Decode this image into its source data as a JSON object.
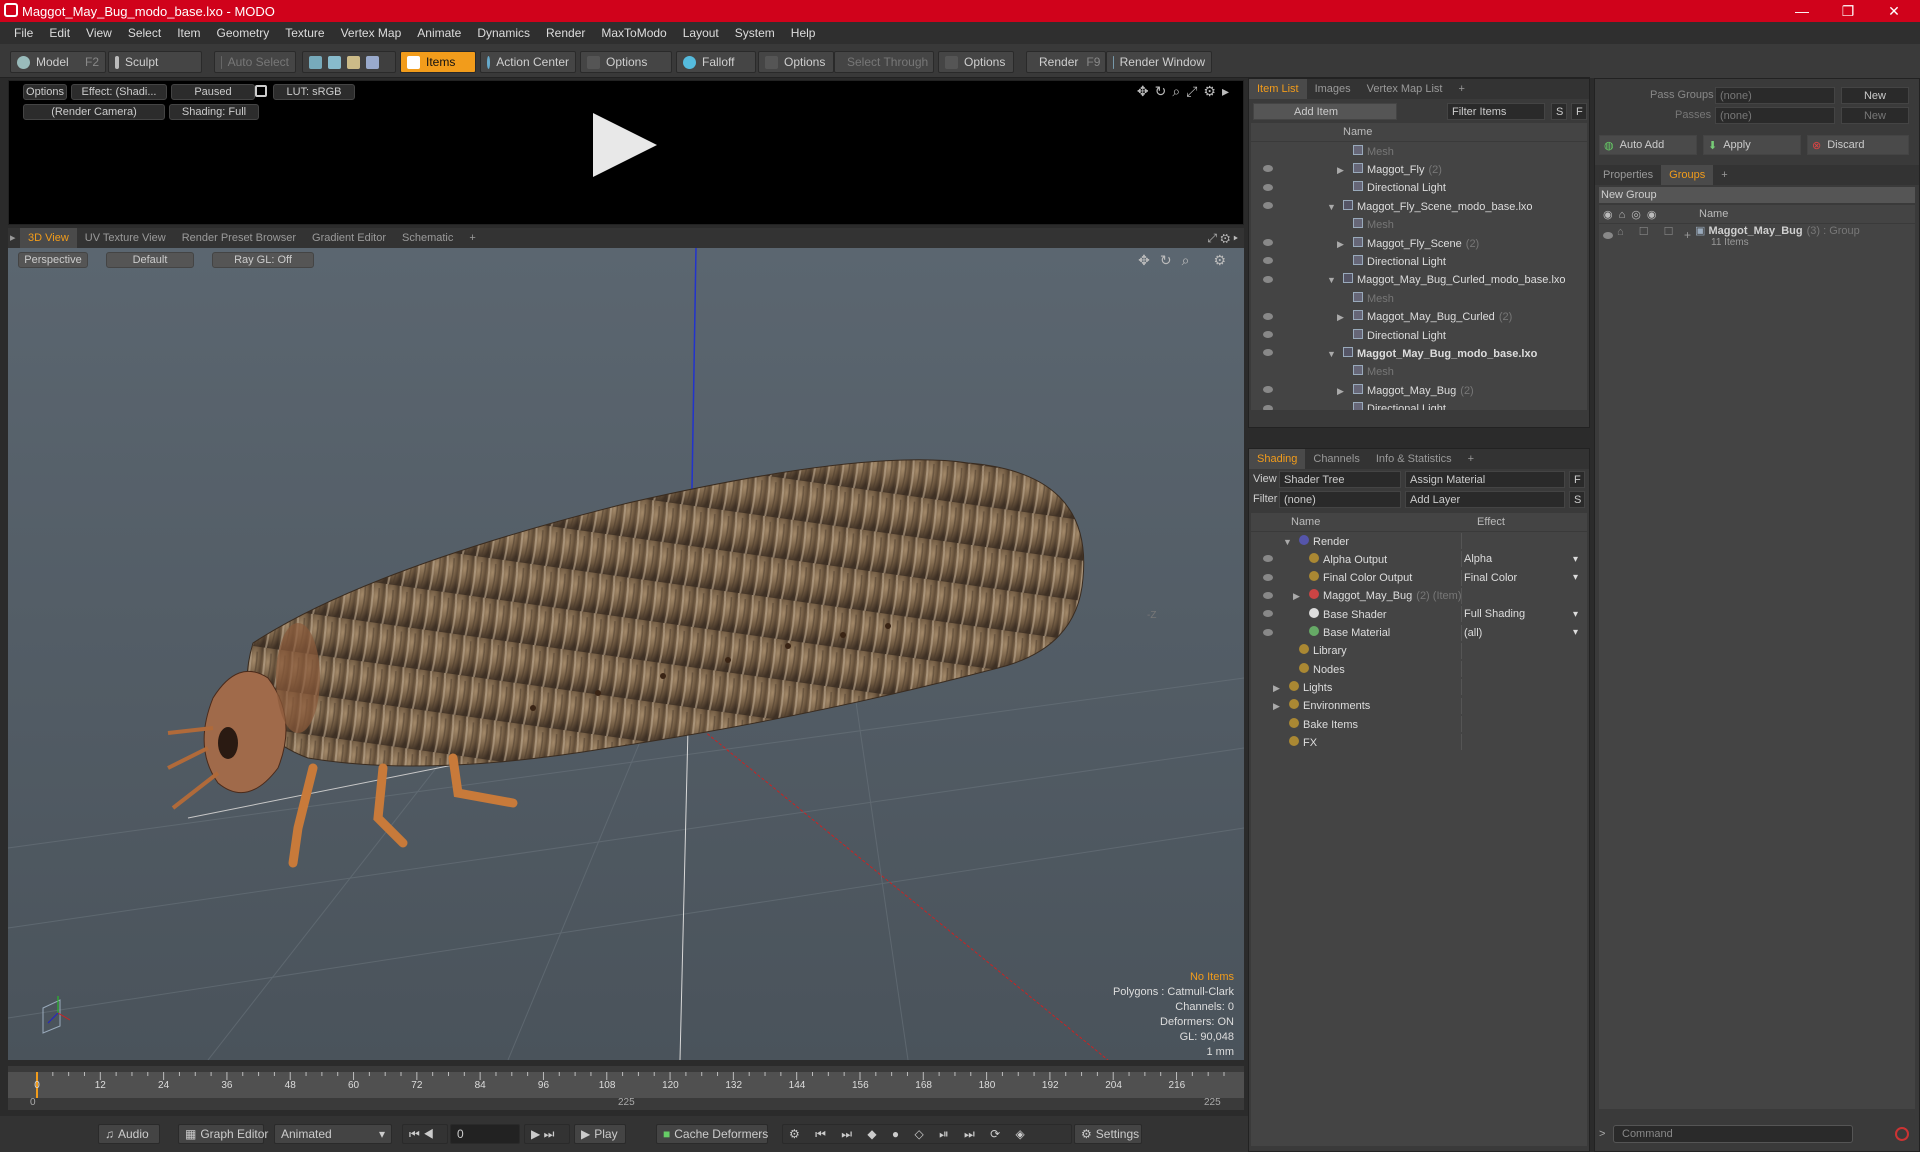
{
  "window": {
    "title": "Maggot_May_Bug_modo_base.lxo - MODO"
  },
  "menu": [
    "File",
    "Edit",
    "View",
    "Select",
    "Item",
    "Geometry",
    "Texture",
    "Vertex Map",
    "Animate",
    "Dynamics",
    "Render",
    "MaxToModo",
    "Layout",
    "System",
    "Help"
  ],
  "toolbar": {
    "model": "Model",
    "model_key": "F2",
    "sculpt": "Sculpt",
    "auto_select": "Auto Select",
    "items": "Items",
    "action_center": "Action Center",
    "options1": "Options",
    "falloff": "Falloff",
    "options2": "Options",
    "select_through": "Select Through",
    "options3": "Options",
    "render": "Render",
    "render_key": "F9",
    "render_window": "Render Window"
  },
  "render_preview": {
    "options": "Options",
    "effect": "Effect: (Shadi...",
    "paused": "Paused",
    "lut": "LUT: sRGB",
    "camera": "(Render Camera)",
    "shading": "Shading: Full"
  },
  "view_tabs": [
    "3D View",
    "UV Texture View",
    "Render Preset Browser",
    "Gradient Editor",
    "Schematic"
  ],
  "viewport": {
    "perspective": "Perspective",
    "default": "Default",
    "raygl": "Ray GL: Off",
    "stats": {
      "no_items": "No Items",
      "polygons": "Polygons : Catmull-Clark",
      "channels": "Channels: 0",
      "deformers": "Deformers: ON",
      "gl": "GL: 90,048",
      "scale": "1 mm"
    },
    "axis_label": "-Z"
  },
  "timeline": {
    "ticks": [
      "0",
      "12",
      "24",
      "36",
      "48",
      "60",
      "72",
      "84",
      "96",
      "108",
      "120",
      "132",
      "144",
      "156",
      "168",
      "180",
      "192",
      "204",
      "216"
    ],
    "sub_start": "0",
    "sub_mid": "225",
    "sub_end": "225"
  },
  "bottom": {
    "audio": "Audio",
    "graph_editor": "Graph Editor",
    "animated": "Animated",
    "frame": "0",
    "play": "Play",
    "cache_deformers": "Cache Deformers",
    "settings": "Settings"
  },
  "item_list": {
    "tabs": [
      "Item List",
      "Images",
      "Vertex Map List"
    ],
    "add_item": "Add Item",
    "filter_items": "Filter Items",
    "s_label": "S",
    "f_label": "F",
    "col_name": "Name",
    "rows": [
      {
        "name": "Mesh",
        "count": "",
        "dim": true,
        "bold": false,
        "indent": 2,
        "exp": ""
      },
      {
        "name": "Maggot_Fly",
        "count": "(2)",
        "dim": false,
        "bold": false,
        "indent": 2,
        "exp": "▶"
      },
      {
        "name": "Directional Light",
        "count": "",
        "dim": false,
        "bold": false,
        "indent": 2,
        "exp": ""
      },
      {
        "name": "Maggot_Fly_Scene_modo_base.lxo",
        "count": "",
        "dim": false,
        "bold": false,
        "indent": 1,
        "exp": "▼"
      },
      {
        "name": "Mesh",
        "count": "",
        "dim": true,
        "bold": false,
        "indent": 2,
        "exp": ""
      },
      {
        "name": "Maggot_Fly_Scene",
        "count": "(2)",
        "dim": false,
        "bold": false,
        "indent": 2,
        "exp": "▶"
      },
      {
        "name": "Directional Light",
        "count": "",
        "dim": false,
        "bold": false,
        "indent": 2,
        "exp": ""
      },
      {
        "name": "Maggot_May_Bug_Curled_modo_base.lxo",
        "count": "",
        "dim": false,
        "bold": false,
        "indent": 1,
        "exp": "▼"
      },
      {
        "name": "Mesh",
        "count": "",
        "dim": true,
        "bold": false,
        "indent": 2,
        "exp": ""
      },
      {
        "name": "Maggot_May_Bug_Curled",
        "count": "(2)",
        "dim": false,
        "bold": false,
        "indent": 2,
        "exp": "▶"
      },
      {
        "name": "Directional Light",
        "count": "",
        "dim": false,
        "bold": false,
        "indent": 2,
        "exp": ""
      },
      {
        "name": "Maggot_May_Bug_modo_base.lxo",
        "count": "",
        "dim": false,
        "bold": true,
        "indent": 1,
        "exp": "▼"
      },
      {
        "name": "Mesh",
        "count": "",
        "dim": true,
        "bold": false,
        "indent": 2,
        "exp": ""
      },
      {
        "name": "Maggot_May_Bug",
        "count": "(2)",
        "dim": false,
        "bold": false,
        "indent": 2,
        "exp": "▶"
      },
      {
        "name": "Directional Light",
        "count": "",
        "dim": false,
        "bold": false,
        "indent": 2,
        "exp": ""
      }
    ]
  },
  "shading": {
    "tabs": [
      "Shading",
      "Channels",
      "Info & Statistics"
    ],
    "view_label": "View",
    "view_value": "Shader Tree",
    "assign_material": "Assign Material",
    "filter_label": "Filter",
    "filter_value": "(none)",
    "add_layer": "Add Layer",
    "f_label": "F",
    "s_label": "S",
    "col_name": "Name",
    "col_effect": "Effect",
    "rows": [
      {
        "name": "Render",
        "effect": "",
        "indent": 1,
        "exp": "▼",
        "eye": false,
        "suffix": ""
      },
      {
        "name": "Alpha Output",
        "effect": "Alpha",
        "indent": 2,
        "exp": "",
        "eye": true,
        "suffix": ""
      },
      {
        "name": "Final Color Output",
        "effect": "Final Color",
        "indent": 2,
        "exp": "",
        "eye": true,
        "suffix": ""
      },
      {
        "name": "Maggot_May_Bug",
        "effect": "",
        "indent": 2,
        "exp": "▶",
        "eye": true,
        "suffix": "(2) (Item)"
      },
      {
        "name": "Base Shader",
        "effect": "Full Shading",
        "indent": 2,
        "exp": "",
        "eye": true,
        "suffix": ""
      },
      {
        "name": "Base Material",
        "effect": "(all)",
        "indent": 2,
        "exp": "",
        "eye": true,
        "suffix": ""
      },
      {
        "name": "Library",
        "effect": "",
        "indent": 1,
        "exp": "",
        "eye": false,
        "suffix": ""
      },
      {
        "name": "Nodes",
        "effect": "",
        "indent": 1,
        "exp": "",
        "eye": false,
        "suffix": ""
      },
      {
        "name": "Lights",
        "effect": "",
        "indent": 0,
        "exp": "▶",
        "eye": false,
        "suffix": ""
      },
      {
        "name": "Environments",
        "effect": "",
        "indent": 0,
        "exp": "▶",
        "eye": false,
        "suffix": ""
      },
      {
        "name": "Bake Items",
        "effect": "",
        "indent": 0,
        "exp": "",
        "eye": false,
        "suffix": ""
      },
      {
        "name": "FX",
        "effect": "",
        "indent": 0,
        "exp": "",
        "eye": false,
        "suffix": ""
      }
    ]
  },
  "groups": {
    "pass_groups": "Pass Groups",
    "pass_groups_value": "(none)",
    "new1": "New",
    "passes": "Passes",
    "passes_value": "(none)",
    "new2": "New",
    "auto_add": "Auto Add",
    "apply": "Apply",
    "discard": "Discard",
    "tabs": [
      "Properties",
      "Groups"
    ],
    "new_group": "New Group",
    "col_name": "Name",
    "group_name": "Maggot_May_Bug",
    "group_count": "(3) : Group",
    "group_items": "11 Items"
  },
  "command": {
    "placeholder": "Command"
  }
}
